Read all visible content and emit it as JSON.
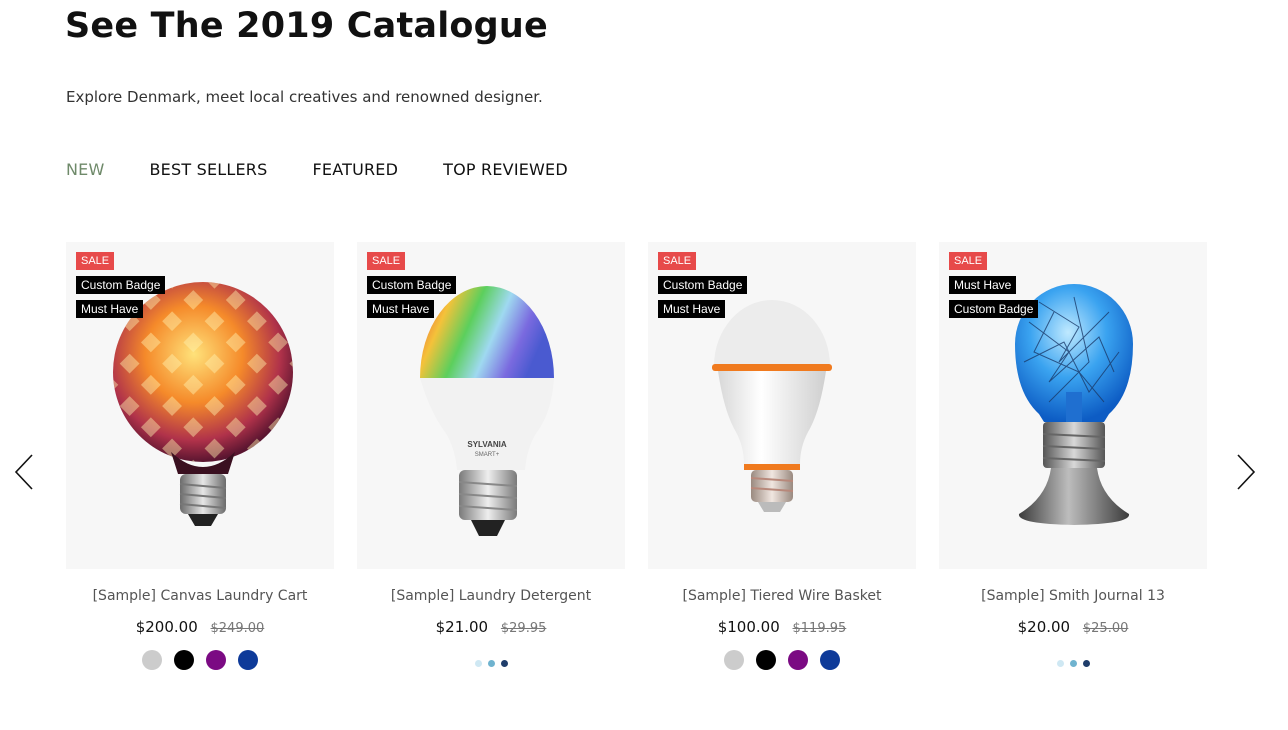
{
  "header": {
    "title": "See The 2019 Catalogue",
    "subtitle": "Explore Denmark, meet local creatives and renowned designer."
  },
  "tabs": [
    {
      "label": "NEW",
      "active": true
    },
    {
      "label": "BEST SELLERS",
      "active": false
    },
    {
      "label": "FEATURED",
      "active": false
    },
    {
      "label": "TOP REVIEWED",
      "active": false
    }
  ],
  "carousel": {
    "prev_icon": "chevron-left-icon",
    "next_icon": "chevron-right-icon"
  },
  "products": [
    {
      "name": "[Sample] Canvas Laundry Cart",
      "price": "$200.00",
      "old_price": "$249.00",
      "badges": [
        "SALE",
        "Custom Badge",
        "Must Have"
      ],
      "image": "decorative-globe-bulb",
      "swatches": [
        "#cccccc",
        "#000000",
        "#7b0a83",
        "#0e3a99"
      ]
    },
    {
      "name": "[Sample] Laundry Detergent",
      "price": "$21.00",
      "old_price": "$29.95",
      "badges": [
        "SALE",
        "Custom Badge",
        "Must Have"
      ],
      "image": "rgb-smart-bulb",
      "image_text": {
        "brand": "SYLVANIA",
        "line": "SMART+"
      },
      "dots": [
        "#cfe8f3",
        "#6fb3cf",
        "#1f3d6b"
      ]
    },
    {
      "name": "[Sample] Tiered Wire Basket",
      "price": "$100.00",
      "old_price": "$119.95",
      "badges": [
        "SALE",
        "Custom Badge",
        "Must Have"
      ],
      "image": "white-led-bulb",
      "swatches": [
        "#cccccc",
        "#000000",
        "#7b0a83",
        "#0e3a99"
      ]
    },
    {
      "name": "[Sample] Smith Journal 13",
      "price": "$20.00",
      "old_price": "$25.00",
      "badges": [
        "SALE",
        "Must Have",
        "Custom Badge"
      ],
      "image": "blue-filament-lamp",
      "dots": [
        "#cfe8f3",
        "#6fb3cf",
        "#1f3d6b"
      ]
    }
  ]
}
